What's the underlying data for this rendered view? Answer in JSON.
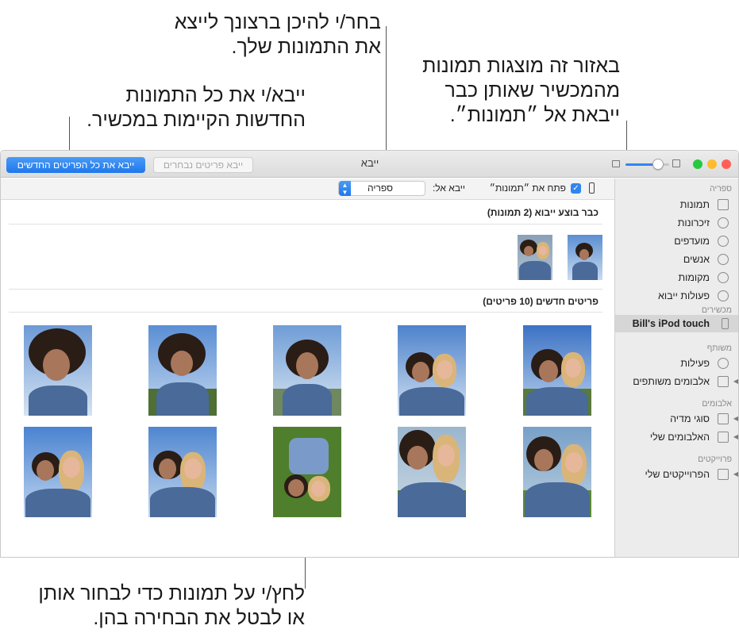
{
  "callouts": {
    "destination": [
      "בחר/י להיכן ברצונך לייצא",
      "את התמונות שלך."
    ],
    "already_imported": [
      "באזור זה מוצגות תמונות",
      "מהמכשיר שאותן כבר",
      "ייבאת אל ״תמונות״."
    ],
    "import_all": [
      "ייבא/י את כל התמונות",
      "החדשות הקיימות במכשיר."
    ],
    "select_photos": [
      "לחץ/י על תמונות כדי לבחור אותן",
      "או לבטל את הבחירה בהן."
    ]
  },
  "window": {
    "title": "ייבא",
    "import_all_button": "ייבא את כל הפריטים החדשים",
    "import_selected_button": "ייבא פריטים נבחרים",
    "open_photos_label": "פתח את ״תמונות״",
    "open_photos_checked": true,
    "import_to_label": "ייבא אל:",
    "import_to_value": "ספריה",
    "already_imported_title": "כבר בוצע ייבוא (2 תמונות)",
    "new_items_title": "פריטים חדשים (10 פריטים)",
    "thumbnail_size_level": 0.75
  },
  "sidebar": {
    "library_header": "ספריה",
    "library_items": [
      "תמונות",
      "זיכרונות",
      "מועדפים",
      "אנשים",
      "מקומות",
      "פעולות ייבוא"
    ],
    "devices_header": "מכשירים",
    "device": "Bill's iPod touch",
    "shared_header": "משותף",
    "shared_items": [
      "פעילות",
      "אלבומים משותפים"
    ],
    "albums_header": "אלבומים",
    "album_items": [
      "סוגי מדיה",
      "האלבומים שלי"
    ],
    "projects_header": "פרוייקטים",
    "project_items": [
      "הפרוייקטים שלי"
    ]
  },
  "colors": {
    "accent_blue": "#2f86f0",
    "traffic_green": "#28c840",
    "traffic_yellow": "#febc2e",
    "traffic_red": "#ff5f57"
  }
}
